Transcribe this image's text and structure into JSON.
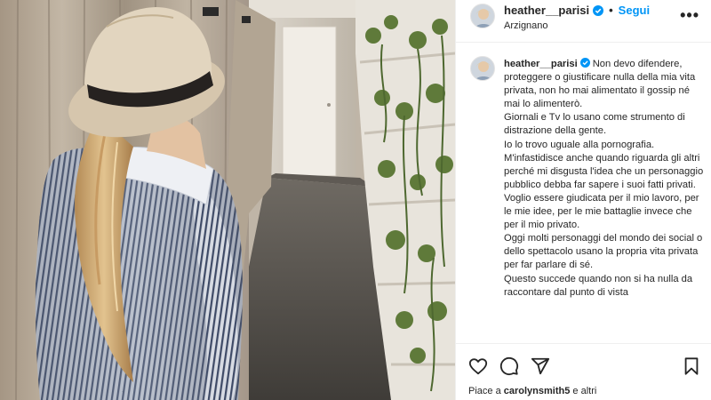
{
  "header": {
    "username": "heather__parisi",
    "follow_label": "Segui",
    "separator": "•",
    "location": "Arzignano",
    "more": "•••"
  },
  "caption": {
    "username": "heather__parisi",
    "text": "Non devo difendere, proteggere o giustificare nulla della mia vita privata, non ho mai alimentato il gossip né mai lo alimenterò.\nGiornali e Tv lo usano come strumento di distrazione della gente.\nIo lo trovo uguale alla pornografia.\nM'infastidisce anche quando riguarda gli altri perché mi disgusta l'idea che un personaggio pubblico debba far sapere i suoi fatti privati.\nVoglio essere giudicata per il mio lavoro, per le mie idee, per le mie battaglie invece che per il mio privato.\nOggi molti personaggi del mondo dei social o dello spettacolo usano la propria vita privata per far parlare di sé.\nQuesto succede quando non si ha nulla da raccontare dal punto di vista"
  },
  "actions": {
    "icons": [
      "heart-icon",
      "comment-icon",
      "share-icon",
      "bookmark-icon"
    ]
  },
  "likes": {
    "prefix": "Piace a",
    "user": "carolynsmith5",
    "suffix": "e altri"
  },
  "colors": {
    "accent": "#0095f6",
    "verified": "#0095f6",
    "text": "#262626",
    "divider": "#efefef"
  }
}
